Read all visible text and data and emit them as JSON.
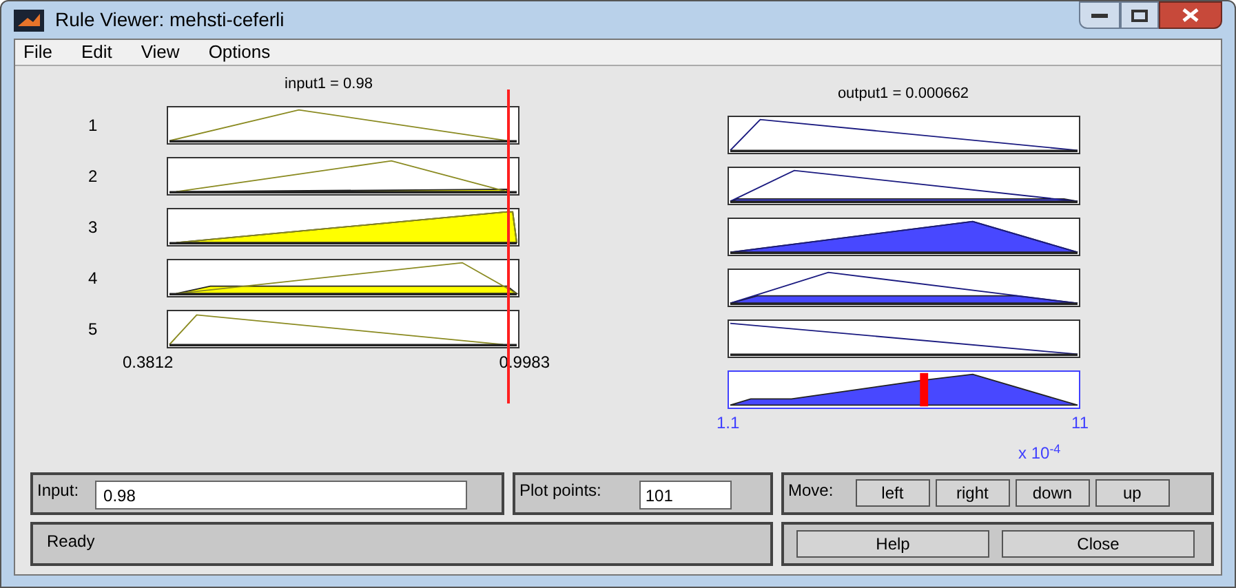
{
  "window": {
    "title": "Rule Viewer: mehsti-ceferli"
  },
  "menu": [
    "File",
    "Edit",
    "View",
    "Options"
  ],
  "input_panel": {
    "header": "input1 = 0.98",
    "axis_min": "0.3812",
    "axis_max": "0.9983",
    "marker": {
      "level": 0.97
    }
  },
  "output_panel": {
    "header": "output1 = 0.000662",
    "axis_min": "1.1",
    "axis_max": "11",
    "multiplier": "x 10$^{-4}$",
    "marker": {
      "level": 0.558
    }
  },
  "rules": [
    {
      "label": "1"
    },
    {
      "label": "2"
    },
    {
      "label": "3"
    },
    {
      "label": "4"
    },
    {
      "label": "5"
    }
  ],
  "input_field": {
    "label": "Input:",
    "value": "0.98"
  },
  "plot_points": {
    "label": "Plot points:",
    "value": "101"
  },
  "move": {
    "label": "Move:",
    "buttons": [
      "left",
      "right",
      "down",
      "up"
    ]
  },
  "status": "Ready",
  "buttons": [
    "Help",
    "Close"
  ]
}
